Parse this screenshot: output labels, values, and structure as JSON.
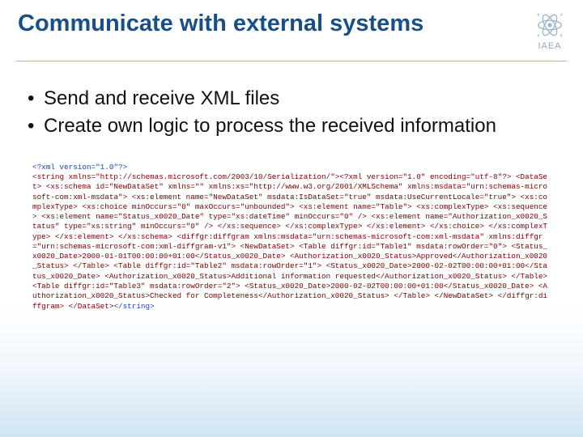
{
  "header": {
    "title": "Communicate with external systems",
    "logo_label": "IAEA"
  },
  "bullets": [
    "Send and receive XML files",
    "Create own logic to process the received information"
  ],
  "xml": {
    "decl": "<?xml version=\"1.0\"?>",
    "body": "<string xmlns=\"http://schemas.microsoft.com/2003/10/Serialization/\"><?xml version=\"1.0\" encoding=\"utf-8\"?> <DataSet> <xs:schema id=\"NewDataSet\" xmlns=\"\" xmlns:xs=\"http://www.w3.org/2001/XMLSchema\" xmlns:msdata=\"urn:schemas-microsoft-com:xml-msdata\"> <xs:element name=\"NewDataSet\" msdata:IsDataSet=\"true\" msdata:UseCurrentLocale=\"true\"> <xs:complexType> <xs:choice minOccurs=\"0\" maxOccurs=\"unbounded\"> <xs:element name=\"Table\"> <xs:complexType> <xs:sequence> <xs:element name=\"Status_x0020_Date\" type=\"xs:dateTime\" minOccurs=\"0\" /> <xs:element name=\"Authorization_x0020_Status\" type=\"xs:string\" minOccurs=\"0\" /> </xs:sequence> </xs:complexType> </xs:element> </xs:choice> </xs:complexType> </xs:element> </xs:schema> <diffgr:diffgram xmlns:msdata=\"urn:schemas-microsoft-com:xml-msdata\" xmlns:diffgr=\"urn:schemas-microsoft-com:xml-diffgram-v1\"> <NewDataSet> <Table diffgr:id=\"Table1\" msdata:rowOrder=\"0\"> <Status_x0020_Date>2000-01-01T00:00:00+01:00</Status_x0020_Date> <Authorization_x0020_Status>Approved</Authorization_x0020_Status> </Table> <Table diffgr:id=\"Table2\" msdata:rowOrder=\"1\"> <Status_x0020_Date>2000-02-02T00:00:00+01:00</Status_x0020_Date> <Authorization_x0020_Status>Additional information requested</Authorization_x0020_Status> </Table> <Table diffgr:id=\"Table3\" msdata:rowOrder=\"2\"> <Status_x0020_Date>2000-02-02T00:00:00+01:00</Status_x0020_Date> <Authorization_x0020_Status>Checked for Completeness</Authorization_x0020_Status> </Table> </NewDataSet> </diffgr:diffgram> </DataSet>",
    "end": "</string>"
  }
}
